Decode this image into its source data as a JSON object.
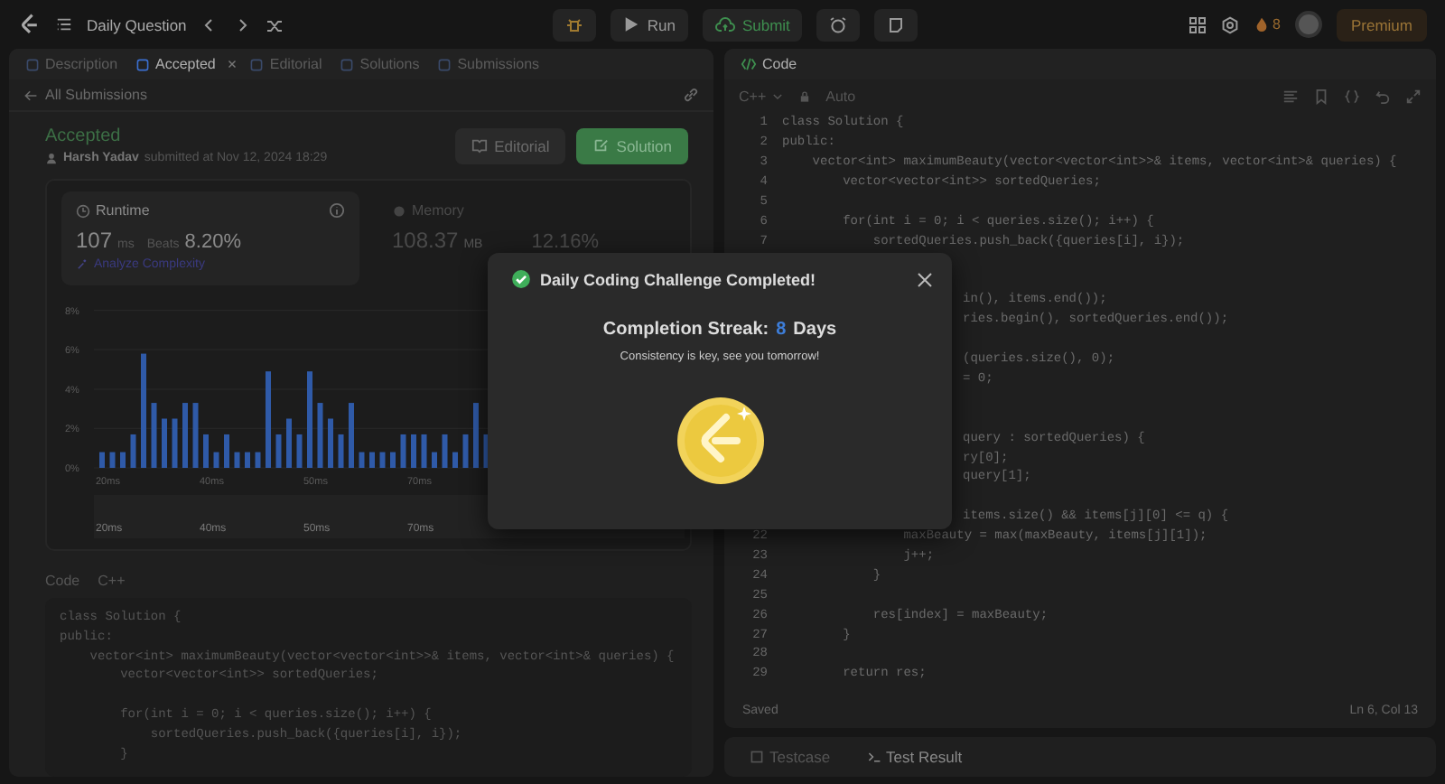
{
  "top_bar": {
    "title": "Daily Question",
    "run": "Run",
    "submit": "Submit",
    "streak_count": "8",
    "premium": "Premium"
  },
  "left_panel": {
    "tabs": [
      {
        "label": "Description",
        "selected": false,
        "closable": false
      },
      {
        "label": "Accepted",
        "selected": true,
        "closable": true
      },
      {
        "label": "Editorial",
        "selected": false,
        "closable": false
      },
      {
        "label": "Solutions",
        "selected": false,
        "closable": false
      },
      {
        "label": "Submissions",
        "selected": false,
        "closable": false
      }
    ],
    "back_link": "All Submissions",
    "status": "Accepted",
    "author": "Harsh Yadav",
    "submitted": "submitted at Nov 12, 2024 18:29",
    "buttons": [
      {
        "label": "Editorial",
        "kind": "plain"
      },
      {
        "label": "Solution",
        "kind": "primary"
      }
    ],
    "runtime": {
      "title": "Runtime",
      "value": "107",
      "unit": "ms",
      "beats_label": "Beats",
      "beats": "8.20%",
      "analyze": "Analyze Complexity"
    },
    "memory": {
      "title": "Memory",
      "value": "108.37",
      "unit": "MB",
      "beats": "12.16%"
    },
    "chart_data": {
      "type": "bar",
      "ylim": [
        0,
        8
      ],
      "grid": true,
      "yticks": [
        {
          "value": 0,
          "label": "0%"
        },
        {
          "value": 2,
          "label": "2%"
        },
        {
          "value": 4,
          "label": "4%"
        },
        {
          "value": 6,
          "label": "6%"
        },
        {
          "value": 8,
          "label": "8%"
        }
      ],
      "categories": [
        "20ms",
        null,
        null,
        null,
        null,
        null,
        null,
        null,
        null,
        null,
        "40ms",
        null,
        null,
        null,
        null,
        null,
        null,
        null,
        null,
        null,
        "50ms",
        null,
        null,
        null,
        null,
        null,
        null,
        null,
        null,
        null,
        "70ms",
        null,
        null,
        null,
        null,
        null,
        null,
        null
      ],
      "series": [
        {
          "color": "#2f5aa8",
          "values": [
            0.8,
            0.8,
            0.8,
            1.7,
            5.8,
            3.3,
            2.5,
            2.5,
            3.3,
            3.3,
            1.7,
            0.8,
            1.7,
            0.8,
            0.8,
            0.8,
            4.9,
            1.7,
            2.5,
            1.7,
            4.9,
            3.3,
            2.5,
            1.7,
            3.3,
            0.8,
            0.8,
            0.8,
            0.8,
            1.7,
            1.7,
            1.7,
            0.8,
            1.7,
            0.8,
            1.7,
            3.3,
            1.7
          ]
        }
      ]
    },
    "overview_labels": [
      "20ms",
      "40ms",
      "50ms",
      "70ms"
    ],
    "code_tabs": [
      "Code",
      "C++"
    ],
    "code": [
      {
        "kind": "code",
        "text": "class Solution {"
      },
      {
        "kind": "code",
        "text": "public:"
      },
      {
        "kind": "code",
        "text": "    vector<int> maximumBeauty(vector<vector<int>>& items, vector<int>& queries) {"
      },
      {
        "kind": "code",
        "text": "        vector<vector<int>> sortedQueries;"
      },
      {
        "kind": "blank"
      },
      {
        "kind": "code",
        "text": "        for(int i = 0; i < queries.size(); i++) {"
      },
      {
        "kind": "code",
        "text": "            sortedQueries.push_back({queries[i], i});"
      },
      {
        "kind": "code",
        "text": "        }"
      }
    ]
  },
  "right_panel": {
    "tab": "Code",
    "language": "C++",
    "mode": "Auto",
    "lines": [
      {
        "num": "1",
        "text": "class Solution {"
      },
      {
        "num": "2",
        "text": "public:"
      },
      {
        "num": "3",
        "text": "    vector<int> maximumBeauty(vector<vector<int>>& items, vector<int>& queries) {"
      },
      {
        "num": "4",
        "text": "        vector<vector<int>> sortedQueries;"
      },
      {
        "num": "5"
      },
      {
        "num": "6",
        "text": "        for(int i = 0; i < queries.size(); i++) {"
      },
      {
        "num": "7",
        "text": "            sortedQueries.push_back({queries[i], i});"
      },
      {
        "kind": "blank"
      },
      {
        "kind": "blank"
      },
      {
        "tail": "in(), items.end());"
      },
      {
        "tail": "ries.begin(), sortedQueries.end());"
      },
      {
        "kind": "blank"
      },
      {
        "tail": "(queries.size(), 0);"
      },
      {
        "tail": "= 0;"
      },
      {
        "kind": "blank"
      },
      {
        "kind": "blank"
      },
      {
        "tail": "query : sortedQueries) {"
      },
      {
        "tail": "ry[0];"
      },
      {
        "tail": "query[1];"
      },
      {
        "kind": "blank"
      },
      {
        "tail": "items.size() && items[j][0] <= q) {"
      },
      {
        "num": "22",
        "text": "                maxBeauty = max(maxBeauty, items[j][1]);"
      },
      {
        "num": "23",
        "text": "                j++;"
      },
      {
        "num": "24",
        "text": "            }"
      },
      {
        "num": "25"
      },
      {
        "num": "26",
        "text": "            res[index] = maxBeauty;"
      },
      {
        "num": "27",
        "text": "        }"
      },
      {
        "num": "28"
      },
      {
        "num": "29",
        "text": "        return res;"
      }
    ],
    "saved": "Saved",
    "cursor": "Ln 6, Col 13",
    "bottom_tabs": [
      {
        "label": "Testcase",
        "selected": false
      },
      {
        "label": "Test Result",
        "selected": true
      }
    ]
  },
  "modal": {
    "title": "Daily Coding Challenge Completed!",
    "streak_label": "Completion Streak:",
    "streak_value": "8",
    "streak_unit": "Days",
    "message": "Consistency is key, see you tomorrow!"
  }
}
